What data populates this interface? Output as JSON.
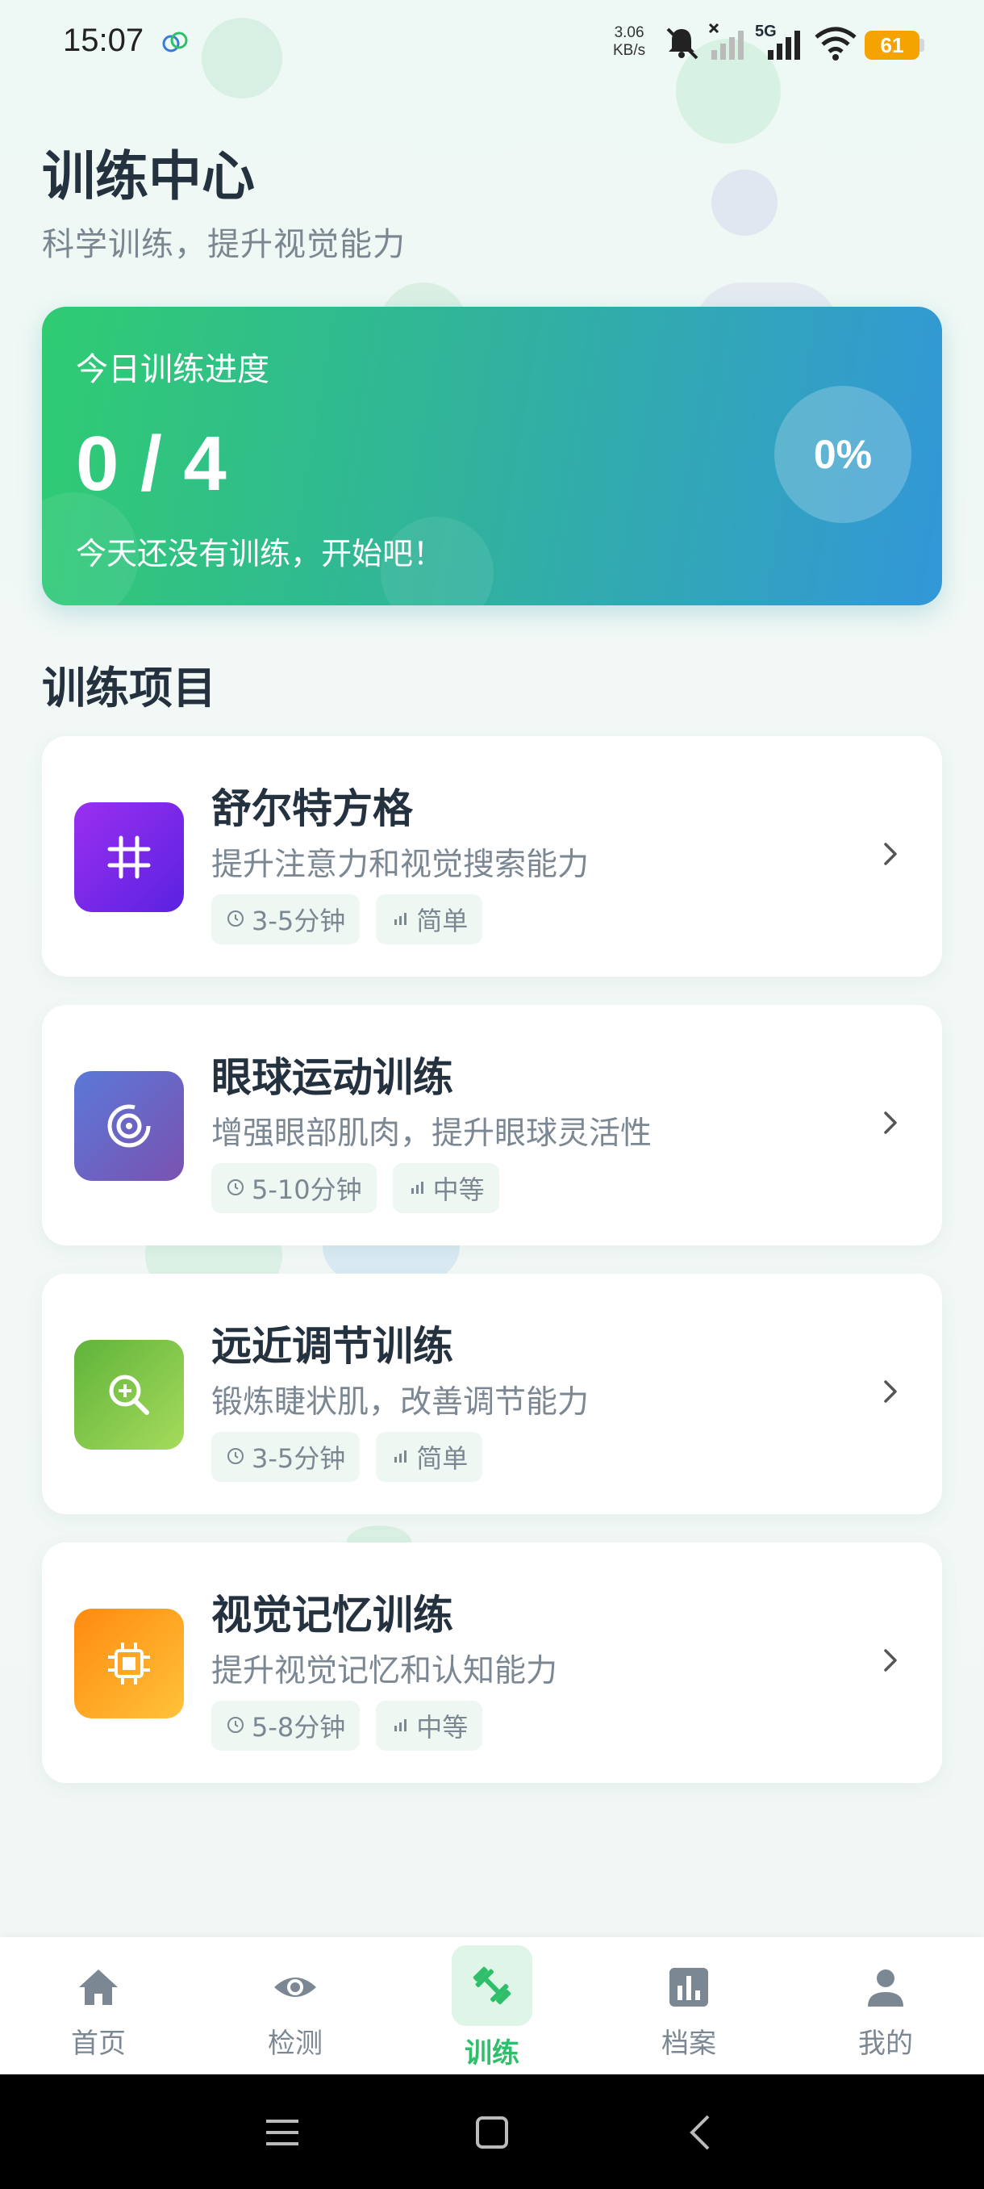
{
  "status_bar": {
    "time": "15:07",
    "net_speed_value": "3.06",
    "net_speed_unit": "KB/s",
    "network_type": "5G",
    "battery": "61"
  },
  "header": {
    "title": "训练中心",
    "subtitle": "科学训练，提升视觉能力"
  },
  "progress": {
    "label": "今日训练进度",
    "count": "0 / 4",
    "message": "今天还没有训练，开始吧！",
    "percent_text": "0%",
    "completed": 0,
    "total": 4
  },
  "section_title": "训练项目",
  "trainings": [
    {
      "name": "舒尔特方格",
      "desc": "提升注意力和视觉搜索能力",
      "duration": "3-5分钟",
      "level": "简单",
      "icon": "grid-icon",
      "color_from": "#9b2ff0",
      "color_to": "#5a22e0"
    },
    {
      "name": "眼球运动训练",
      "desc": "增强眼部肌肉，提升眼球灵活性",
      "duration": "5-10分钟",
      "level": "中等",
      "icon": "target-icon",
      "color_from": "#5b78d8",
      "color_to": "#7a52b0"
    },
    {
      "name": "远近调节训练",
      "desc": "锻炼睫状肌，改善调节能力",
      "duration": "3-5分钟",
      "level": "简单",
      "icon": "zoom-icon",
      "color_from": "#5fb33a",
      "color_to": "#a6db5c"
    },
    {
      "name": "视觉记忆训练",
      "desc": "提升视觉记忆和认知能力",
      "duration": "5-8分钟",
      "level": "中等",
      "icon": "chip-icon",
      "color_from": "#ff8a10",
      "color_to": "#ffc23a"
    }
  ],
  "nav": {
    "items": [
      {
        "label": "首页",
        "icon": "home-icon"
      },
      {
        "label": "检测",
        "icon": "eye-icon"
      },
      {
        "label": "训练",
        "icon": "dumbbell-icon",
        "active": true
      },
      {
        "label": "档案",
        "icon": "chart-icon"
      },
      {
        "label": "我的",
        "icon": "user-icon"
      }
    ]
  },
  "colors": {
    "accent": "#2fbf6a",
    "text_primary": "#24313f",
    "text_secondary": "#7b8792"
  }
}
